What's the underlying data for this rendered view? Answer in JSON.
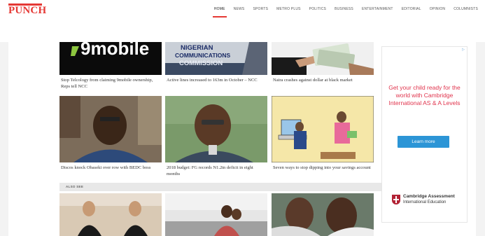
{
  "site": {
    "logo_text": "PUNCH",
    "brand_color": "#e53935"
  },
  "nav": {
    "items": [
      "HOME",
      "NEWS",
      "SPORTS",
      "METRO PLUS",
      "POLITICS",
      "BUSINESS",
      "ENTERTAINMENT",
      "EDITORIAL",
      "OPINION",
      "COLUMNISTS"
    ],
    "active": "HOME"
  },
  "articles": [
    {
      "caption": "Stop Telcology from claiming 9mobile ownership, Reps tell NCC",
      "thumb_text": "9mobile"
    },
    {
      "caption": "Active lines increased to 163m in October – NCC",
      "thumb_text": "NIGERIAN COMMUNICATIONS COMMISSION"
    },
    {
      "caption": "Naira crashes against dollar at black market"
    },
    {
      "caption": "Discos knock Obaseki over row with BEDC boss"
    },
    {
      "caption": "2018 budget: FG records N1.2tn deficit in eight months"
    },
    {
      "caption": "Seven ways to stop dipping into your savings account"
    }
  ],
  "also_see_label": "ALSO SEE",
  "ad": {
    "headline": "Get your child ready for the world with Cambridge International AS & A Levels",
    "button": "Learn more",
    "brand_line1": "Cambridge Assessment",
    "brand_line2": "International Education",
    "accent": "#e0334c",
    "button_color": "#2c95d6"
  }
}
